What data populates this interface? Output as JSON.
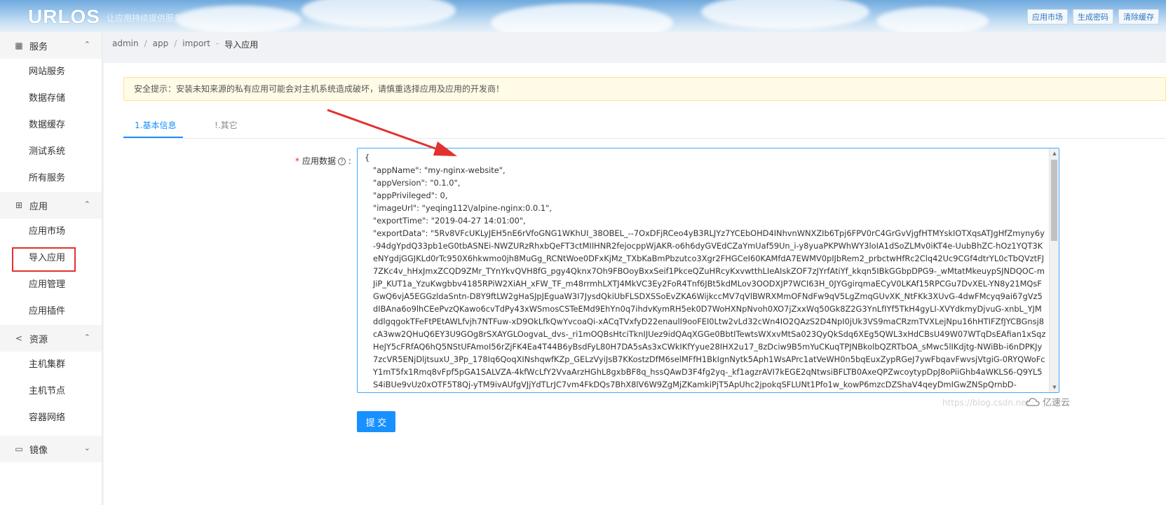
{
  "header": {
    "logo": "URLOS",
    "slogan": "让应用持续提供服务",
    "buttons": [
      "应用市场",
      "生成密码",
      "清除缓存"
    ]
  },
  "sidebar": {
    "groups": [
      {
        "label": "服务",
        "icon": "grid-icon",
        "items": [
          "网站服务",
          "数据存储",
          "数据缓存",
          "测试系统",
          "所有服务"
        ]
      },
      {
        "label": "应用",
        "icon": "apps-icon",
        "items": [
          "应用市场",
          "导入应用",
          "应用管理",
          "应用插件"
        ]
      },
      {
        "label": "资源",
        "icon": "share-icon",
        "items": [
          "主机集群",
          "主机节点",
          "容器网络"
        ]
      },
      {
        "label": "镜像",
        "icon": "disk-icon",
        "items": []
      }
    ]
  },
  "breadcrumb": {
    "parts": [
      "admin",
      "app",
      "import"
    ],
    "current": "导入应用"
  },
  "alert": {
    "text": "安全提示：安装未知来源的私有应用可能会对主机系统造成破坏，请慎重选择应用及应用的开发商！"
  },
  "tabs": {
    "tab1": "1.基本信息",
    "tab2": "!.其它"
  },
  "form": {
    "label": "应用数据",
    "submit": "提 交",
    "data_lines": [
      "{",
      "\"appName\": \"my-nginx-website\",",
      "\"appVersion\": \"0.1.0\",",
      "\"appPrivileged\": 0,",
      "\"imageUrl\": \"yeqing112\\/alpine-nginx:0.0.1\",",
      "\"exportTime\": \"2019-04-27 14:01:00\","
    ],
    "export_data": "\"exportData\": \"5Rv8VFcUKLyJEH5nE6rVfoGNG1WKhUI_38OBEL_--7OxDFjRCeo4yB3RLJYz7YCEbOHD4INhvnWNXZIb6Tpj6FPV0rC4GrGvVjgfHTMYskIOTXqsATJgHfZmyny6y-94dgYpdQ33pb1eG0tbASNEi-NWZURzRhxbQeFT3ctMIIHNR2fejocppWjAKR-o6h6dyGVEdCZaYmUaf59Un_i-y8yuaPKPWhWY3loIA1dSoZLMv0iKT4e-UubBhZC-hOz1YQT3KeNYgdjGGJKLd0rTc950X6hkwmo0jh8MuGg_RCNtWoe0DFxKjMz_TXbKaBmPbzutco3Xgr2FHGCeI60KAMfdA7EWMV0pIJbRem2_prbctwHfRc2Clq42Uc9CGf4dtrYL0cTbQVztFJ7ZKc4v_hHxJmxZCQD9ZMr_TYnYkvQVH8fG_pgy4Qknx7Oh9FBOoyBxxSeif1PkceQZuHRcyKxvwtthLIeAIskZOF7zJYrfAtiYf_kkqn5IBkGGbpDPG9-_wMtatMkeuypSJNDQOC-mJiP_KUT1a_YzuKwgbbv4185RPiW2XiAH_xFW_TF_m48rrmhLXTJ4MkVC3Ey2FoR4Tnf6JBt5kdMLov3OODXJP7WCI63H_0JYGgirqmaECyV0LKAf15RPCGu7DvXEL-YN8y21MQsFGwQ6vjA5EGGzldaSntn-D8Y9ftLW2gHaSJpJEguaW3I7JysdQkiUbFLSDXSSoEvZKA6WijkccMV7qVlBWRXMmOFNdFw9qV5LgZmqGUvXK_NtFKk3XUvG-4dwFMcyq9ai67gVz5dIBAna6o9lhCEePvzQKawo6cvTdPy43xWSmosCSTeEMd9EhYn0q7ihdvKymRH5ek0D7WoHXNpNvoh0XO7jZxxWq50Gk8Z2G3YnLfIYf5TkH4gyLI-XVYdkmyDjvuG-xnbL_YJMddlgqgokTFeFtPEtAWLfvjh7NTFuw-xD9OkLfkQwYvcoaQi-xACqTVxfyD22enaulI9ooFEI0Ltw2vLd32cWn4IO2QAzS2D4NpI0jUk3VS9maCRzmTVXLejNpu16hHTIFZfJYCBGnsj8cA3ww2QHuQ6EY3U9GOg8rSXAYGLOogvaL_dvs-_ri1mOQBsHtciTknIJUez9idQAqXGGe0BbtITewtsWXxvMtSa023QyQkSdq6XEg5QWL3xHdCBsU49W07WTqDsEAfian1xSqzHeJY5cFRfAQ6hQ5NStUFAmoI56rZjFK4Ea4T44B6yBsdFyL80H7DA5sAs3xCWkIKfYyue28IHX2u17_8zDciw9B5mYuCKuqTPJNBkolbQZRTbOA_sMwc5lIKdjtg-NWiBb-i6nDPKJy7zcVR5ENjDljtsuxU_3Pp_178Iq6QoqXINshqwfKZp_GELzVyiJsB7KKostzDfM6selMFfH1BkIgnNytk5Aph1WsAPrc1atVeWH0n5bqEuxZypRGeJ7ywFbqavFwvsjVtgiG-0RYQWoFcY1mT5fx1Rmq8vFpf5pGA1SALVZA-4kfWcLfY2VvaArzHGhL8gxbBF8q_hssQAwD3F4fg2yq-_kf1agzrAVI7kEGE2qNtwsiBFLTB0AxeQPZwcoytypDpJ8oPiiGhb4aWKLS6-Q9YL5S4iBUe9vUz0xOTF5T8Qj-yTM9ivAUfgVJjYdTLrJC7vm4FkDQs7BhX8lV6W9ZgMjZKamkiPjT5ApUhc2jpokqSFLUNt1Pfo1w_kowP6mzcDZShaV4qeyDmIGwZNSpQrnbD-"
  },
  "watermark": {
    "url": "https://blog.csdn.net",
    "brand": "亿速云"
  }
}
